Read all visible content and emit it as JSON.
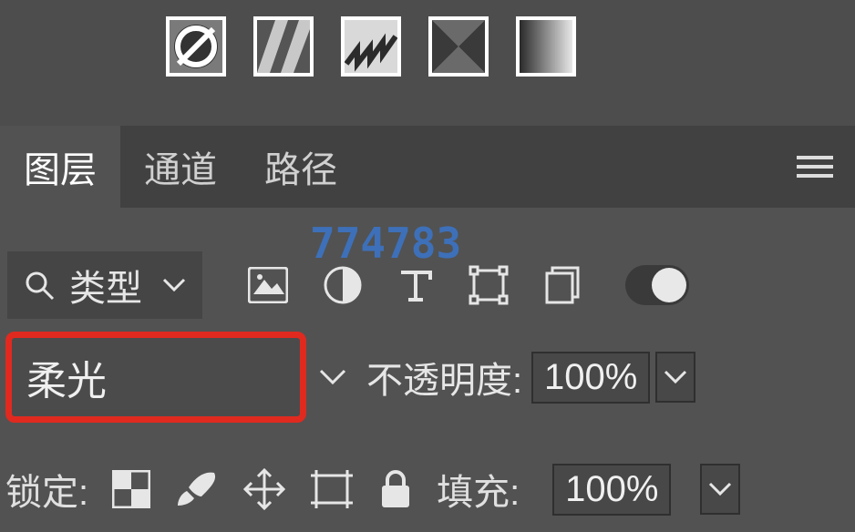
{
  "watermark": "774783",
  "tabs": {
    "layers": "图层",
    "channels": "通道",
    "paths": "路径"
  },
  "kind_filter": {
    "label": "类型"
  },
  "blend_mode": {
    "value": "柔光"
  },
  "opacity": {
    "label": "不透明度:",
    "value": "100%"
  },
  "lock": {
    "label": "锁定:"
  },
  "fill": {
    "label": "填充:",
    "value": "100%"
  },
  "top_thumbs": [
    "denied-circle",
    "stripes",
    "zigzag",
    "envelope",
    "gradient"
  ]
}
